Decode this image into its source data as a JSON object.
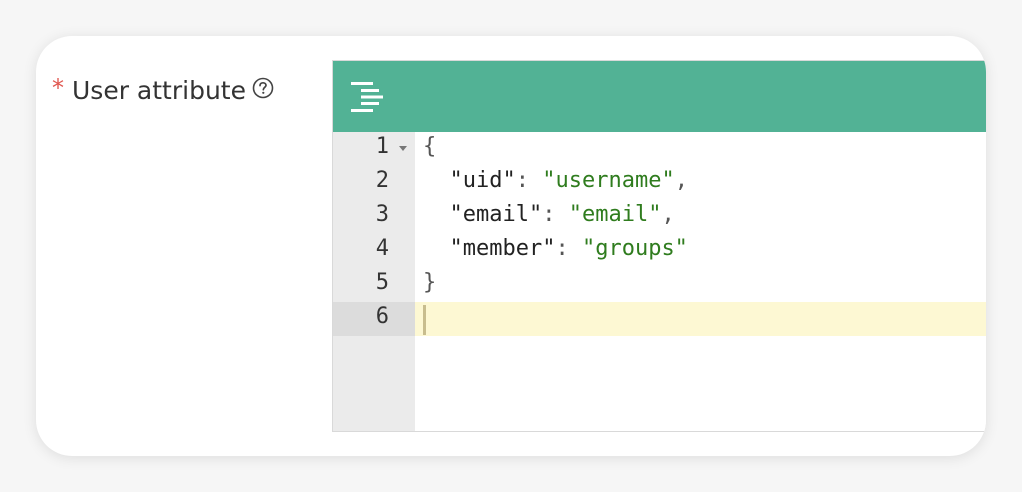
{
  "field": {
    "required_mark": "*",
    "label": "User attribute",
    "help_icon": "question-circle-icon"
  },
  "toolbar": {
    "background": "#52b295",
    "format_icon": "format-align-icon"
  },
  "editor": {
    "lines": [
      {
        "number": "1",
        "foldable": true,
        "tokens": [
          {
            "t": "{",
            "c": "punct"
          }
        ]
      },
      {
        "number": "2",
        "foldable": false,
        "tokens": [
          {
            "t": "  ",
            "c": "punct"
          },
          {
            "t": "\"uid\"",
            "c": "key"
          },
          {
            "t": ": ",
            "c": "punct"
          },
          {
            "t": "\"username\"",
            "c": "str"
          },
          {
            "t": ",",
            "c": "punct"
          }
        ]
      },
      {
        "number": "3",
        "foldable": false,
        "tokens": [
          {
            "t": "  ",
            "c": "punct"
          },
          {
            "t": "\"email\"",
            "c": "key"
          },
          {
            "t": ": ",
            "c": "punct"
          },
          {
            "t": "\"email\"",
            "c": "str"
          },
          {
            "t": ",",
            "c": "punct"
          }
        ]
      },
      {
        "number": "4",
        "foldable": false,
        "tokens": [
          {
            "t": "  ",
            "c": "punct"
          },
          {
            "t": "\"member\"",
            "c": "key"
          },
          {
            "t": ": ",
            "c": "punct"
          },
          {
            "t": "\"groups\"",
            "c": "str"
          }
        ]
      },
      {
        "number": "5",
        "foldable": false,
        "tokens": [
          {
            "t": "}",
            "c": "punct"
          }
        ]
      },
      {
        "number": "6",
        "foldable": false,
        "tokens": [],
        "active": true
      }
    ]
  }
}
